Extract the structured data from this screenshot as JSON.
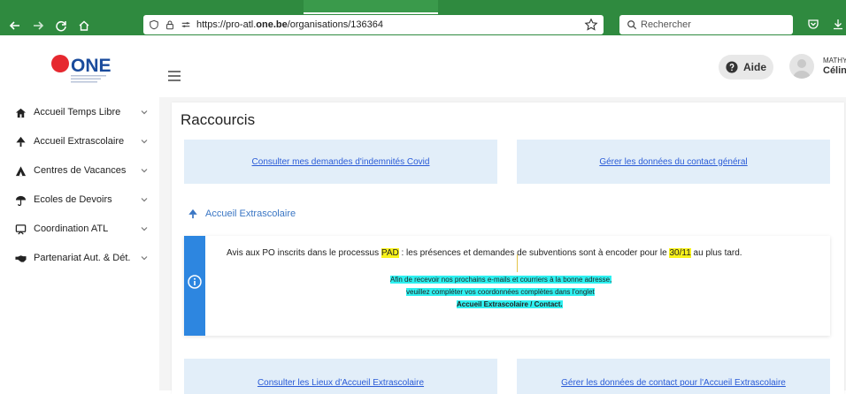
{
  "browser": {
    "url_prefix": "https://pro-atl.",
    "url_domain": "one.be",
    "url_path": "/organisations/136364",
    "search_placeholder": "Rechercher"
  },
  "header": {
    "logo_text": "ONE",
    "help_label": "Aide",
    "user_last": "MATHY",
    "user_first": "Céline"
  },
  "sidebar": {
    "items": [
      {
        "label": "Accueil Temps Libre",
        "icon": "house-icon"
      },
      {
        "label": "Accueil Extrascolaire",
        "icon": "tree-icon"
      },
      {
        "label": "Centres de Vacances",
        "icon": "tent-icon"
      },
      {
        "label": "Ecoles de Devoirs",
        "icon": "umbrella-icon"
      },
      {
        "label": "Coordination ATL",
        "icon": "coordination-icon"
      },
      {
        "label": "Partenariat Aut. & Dét.",
        "icon": "handshake-icon"
      }
    ]
  },
  "main": {
    "title": "Raccourcis",
    "shortcuts": [
      {
        "label": "Consulter mes demandes d'indemnités Covid"
      },
      {
        "label": "Gérer les données du contact général"
      },
      {
        "label": "Consulter les Lieux d'Accueil Extrascolaire"
      },
      {
        "label": "Gérer les données de contact pour l'Accueil Extrascolaire"
      }
    ],
    "section_title": "Accueil Extrascolaire",
    "notice": {
      "part1": "Avis aux PO inscrits dans le processus ",
      "pad": "PAD",
      "part2": " : les présences et demandes de subventions sont à encoder pour le ",
      "date": "30/11",
      "part3": " au plus tard.",
      "line1": "Afin de recevoir nos prochains e-mails et courriers à la bonne adresse,",
      "line2": "veuillez compléter vos coordonnées complètes dans l'onglet",
      "line3": "Accueil Extrascolaire / Contact."
    }
  },
  "colors": {
    "browser_bar": "#2f8a3f",
    "accent_blue": "#2d86e0",
    "shortcut_bg": "#e2eef9",
    "highlight_yellow": "#f8f21a",
    "highlight_cyan": "#2ef0f0",
    "logo_red": "#e6282f",
    "logo_blue": "#1a4b9c"
  }
}
